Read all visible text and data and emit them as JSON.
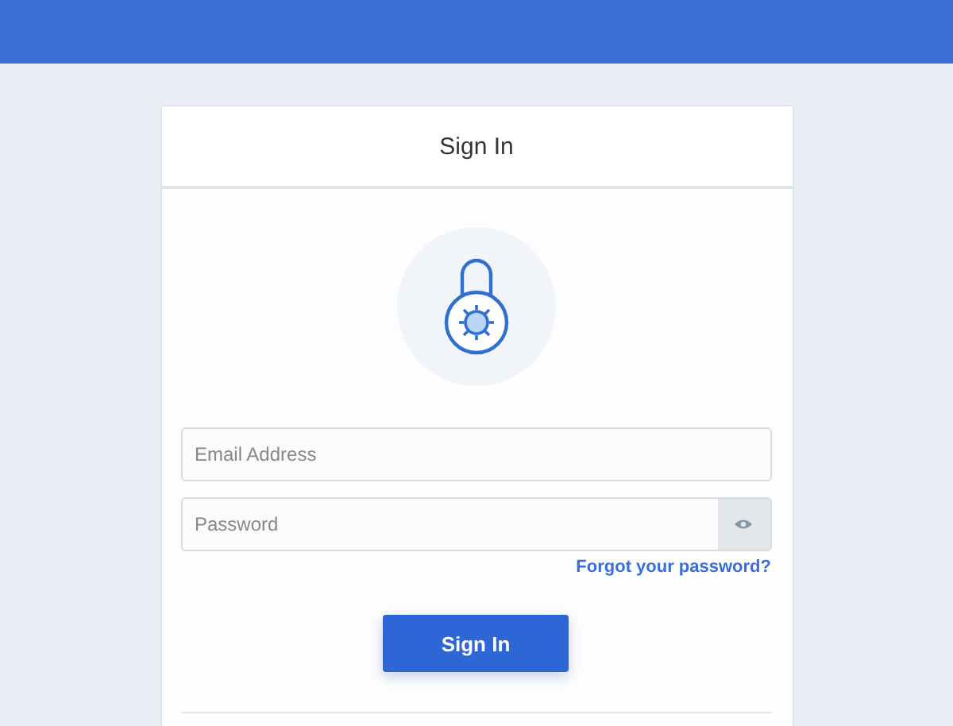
{
  "card": {
    "title": "Sign In"
  },
  "email_field": {
    "placeholder": "Email Address"
  },
  "password_field": {
    "placeholder": "Password"
  },
  "forgot_link": "Forgot your password?",
  "submit_button": "Sign In"
}
